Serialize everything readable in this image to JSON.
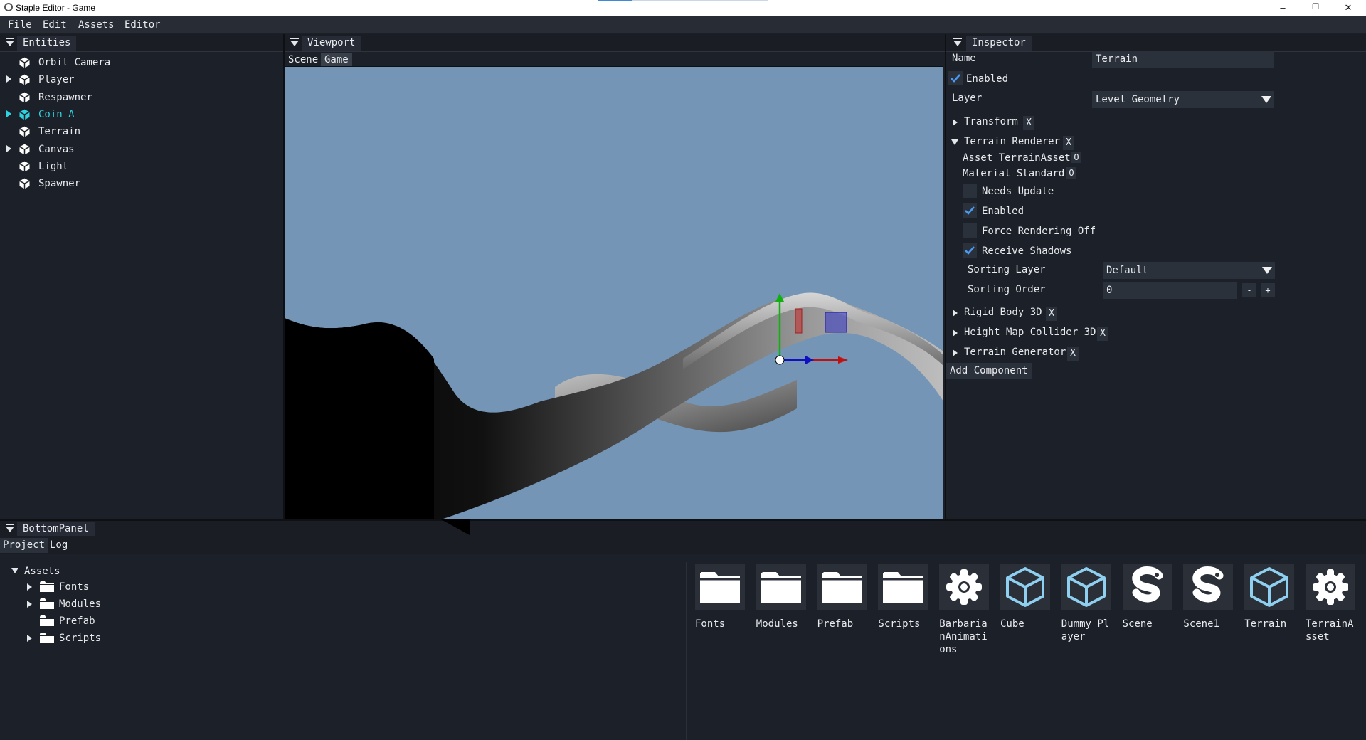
{
  "window": {
    "title": "Staple Editor - Game",
    "controls": {
      "minimize": "–",
      "maximize": "❐",
      "close": "✕"
    }
  },
  "menu": [
    "File",
    "Edit",
    "Assets",
    "Editor"
  ],
  "entities": {
    "tab": "Entities",
    "items": [
      {
        "label": "Orbit Camera",
        "has_children": false,
        "selected": false
      },
      {
        "label": "Player",
        "has_children": true,
        "selected": false
      },
      {
        "label": "Respawner",
        "has_children": false,
        "selected": false
      },
      {
        "label": "Coin_A",
        "has_children": true,
        "selected": true
      },
      {
        "label": "Terrain",
        "has_children": false,
        "selected": false
      },
      {
        "label": "Canvas",
        "has_children": true,
        "selected": false
      },
      {
        "label": "Light",
        "has_children": false,
        "selected": false
      },
      {
        "label": "Spawner",
        "has_children": false,
        "selected": false
      }
    ]
  },
  "viewport": {
    "tab": "Viewport",
    "subtabs": [
      "Scene",
      "Game"
    ],
    "active_subtab": "Game"
  },
  "inspector": {
    "tab": "Inspector",
    "name_label": "Name",
    "name_value": "Terrain",
    "enabled_label": "Enabled",
    "enabled": true,
    "layer_label": "Layer",
    "layer_value": "Level Geometry",
    "components": [
      {
        "label": "Transform",
        "remove": "X",
        "expanded": false
      },
      {
        "label": "Terrain Renderer",
        "remove": "X",
        "expanded": true
      },
      {
        "label": "Rigid Body 3D",
        "remove": "X",
        "expanded": false
      },
      {
        "label": "Height Map Collider 3D",
        "remove": "X",
        "expanded": false
      },
      {
        "label": "Terrain Generator",
        "remove": "X",
        "expanded": false
      }
    ],
    "terrain_renderer": {
      "asset_label": "Asset TerrainAsset",
      "asset_btn": "O",
      "material_label": "Material Standard",
      "material_btn": "O",
      "checkboxes": [
        {
          "label": "Needs Update",
          "checked": false
        },
        {
          "label": "Enabled",
          "checked": true
        },
        {
          "label": "Force Rendering Off",
          "checked": false
        },
        {
          "label": "Receive Shadows",
          "checked": true
        }
      ],
      "sorting_layer_label": "Sorting Layer",
      "sorting_layer_value": "Default",
      "sorting_order_label": "Sorting Order",
      "sorting_order_value": "0",
      "minus": "-",
      "plus": "+"
    },
    "add_component": "Add Component"
  },
  "bottom": {
    "tab": "BottomPanel",
    "subtabs": [
      "Project",
      "Log"
    ],
    "active_subtab": "Project",
    "tree": {
      "root": "Assets",
      "children": [
        {
          "label": "Fonts",
          "has_children": true
        },
        {
          "label": "Modules",
          "has_children": true
        },
        {
          "label": "Prefab",
          "has_children": false
        },
        {
          "label": "Scripts",
          "has_children": true
        }
      ]
    },
    "assets": [
      {
        "name": "Fonts",
        "icon": "folder-icon"
      },
      {
        "name": "Modules",
        "icon": "folder-icon"
      },
      {
        "name": "Prefab",
        "icon": "folder-icon"
      },
      {
        "name": "Scripts",
        "icon": "folder-icon"
      },
      {
        "name": "BarbarianAnimations",
        "icon": "gear-icon"
      },
      {
        "name": "Cube",
        "icon": "cube-icon"
      },
      {
        "name": "Dummy Player",
        "icon": "cube-icon"
      },
      {
        "name": "Scene",
        "icon": "staple-logo-icon"
      },
      {
        "name": "Scene1",
        "icon": "staple-logo-icon"
      },
      {
        "name": "Terrain",
        "icon": "cube-icon"
      },
      {
        "name": "TerrainAsset",
        "icon": "gear-icon"
      }
    ]
  },
  "colors": {
    "panel_bg": "#1c2028",
    "sky": "#7595b6",
    "selected_text": "#2fd3e0",
    "check": "#4a9bf5",
    "asset_icon_blue": "#8fd0f0"
  }
}
